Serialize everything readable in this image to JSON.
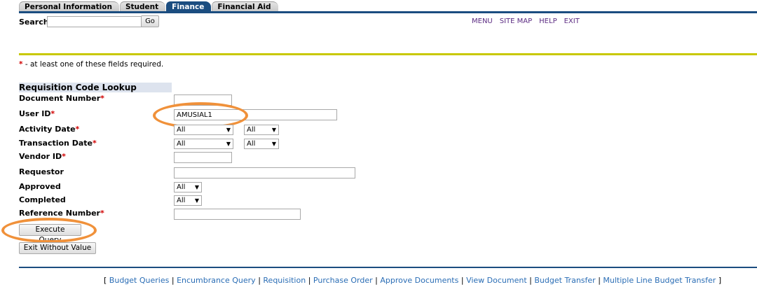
{
  "tabs": [
    {
      "label": "Personal Information"
    },
    {
      "label": "Student"
    },
    {
      "label": "Finance"
    },
    {
      "label": "Financial Aid"
    }
  ],
  "search": {
    "label": "Search",
    "value": "",
    "go_label": "Go"
  },
  "toplinks": [
    "MENU",
    "SITE MAP",
    "HELP",
    "EXIT"
  ],
  "required_note": {
    "star": "*",
    "text": " - at least one of these fields required."
  },
  "form": {
    "title": "Requisition Code Lookup",
    "fields": {
      "document_number": {
        "label": "Document Number",
        "star": "*",
        "value": ""
      },
      "user_id": {
        "label": "User ID",
        "star": "*",
        "value": "AMUSIAL1"
      },
      "activity_date": {
        "label": "Activity Date",
        "star": "*",
        "sel1": "All",
        "sel2": "All"
      },
      "transaction_date": {
        "label": "Transaction Date",
        "star": "*",
        "sel1": "All",
        "sel2": "All"
      },
      "vendor_id": {
        "label": "Vendor ID",
        "star": "*",
        "value": ""
      },
      "requestor": {
        "label": "Requestor",
        "value": ""
      },
      "approved": {
        "label": "Approved",
        "sel": "All"
      },
      "completed": {
        "label": "Completed",
        "sel": "All"
      },
      "reference_number": {
        "label": "Reference Number",
        "star": "*",
        "value": ""
      }
    },
    "execute_label": "Execute Query",
    "exit_label": "Exit Without Value"
  },
  "dropdown_arrow": "▼",
  "footer": {
    "open": "[",
    "close": "]",
    "sep": "|",
    "links": [
      "Budget Queries",
      "Encumbrance Query",
      "Requisition",
      "Purchase Order",
      "Approve Documents",
      "View Document",
      "Budget Transfer",
      "Multiple Line Budget Transfer"
    ]
  },
  "colors": {
    "nav_blue": "#1b4d80",
    "rule_yellow": "#c8c800",
    "link_purple": "#5b2b82",
    "required_red": "#d10000",
    "highlight_orange": "#f0913a"
  }
}
